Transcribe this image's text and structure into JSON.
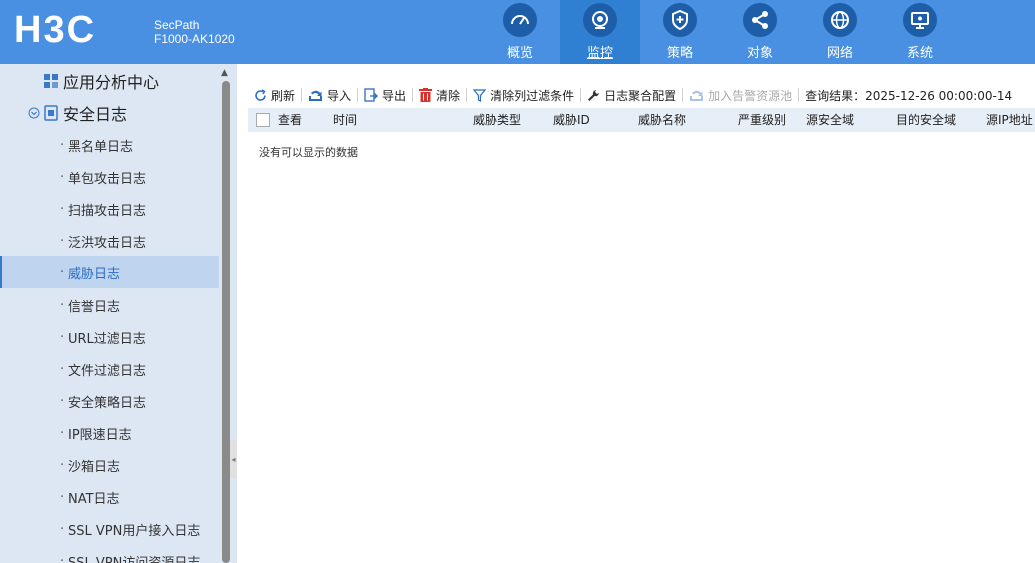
{
  "brand": {
    "logo_text": "H3C",
    "product_line": "SecPath",
    "model": "F1000-AK1020"
  },
  "nav": {
    "items": [
      {
        "label": "概览",
        "icon": "gauge-icon"
      },
      {
        "label": "监控",
        "icon": "camera-icon",
        "active": true
      },
      {
        "label": "策略",
        "icon": "shield-icon"
      },
      {
        "label": "对象",
        "icon": "share-icon"
      },
      {
        "label": "网络",
        "icon": "globe-icon"
      },
      {
        "label": "系统",
        "icon": "monitor-icon"
      }
    ]
  },
  "sidebar": {
    "group1": "应用分析中心",
    "group2": "安全日志",
    "items": [
      {
        "label": "黑名单日志"
      },
      {
        "label": "单包攻击日志"
      },
      {
        "label": "扫描攻击日志"
      },
      {
        "label": "泛洪攻击日志"
      },
      {
        "label": "威胁日志",
        "active": true
      },
      {
        "label": "信誉日志"
      },
      {
        "label": "URL过滤日志"
      },
      {
        "label": "文件过滤日志"
      },
      {
        "label": "安全策略日志"
      },
      {
        "label": "IP限速日志"
      },
      {
        "label": "沙箱日志"
      },
      {
        "label": "NAT日志"
      },
      {
        "label": "SSL VPN用户接入日志"
      },
      {
        "label": "SSL VPN访问资源日志"
      }
    ]
  },
  "toolbar": {
    "refresh": "刷新",
    "import": "导入",
    "export": "导出",
    "clear": "清除",
    "clear_filters": "清除列过滤条件",
    "aggregate": "日志聚合配置",
    "add_alarm": "加入告警资源池",
    "query_result": "查询结果：2025-12-26 00:00:00-14"
  },
  "table": {
    "columns": [
      "查看",
      "时间",
      "威胁类型",
      "威胁ID",
      "威胁名称",
      "严重级别",
      "源安全域",
      "目的安全域",
      "源IP地址"
    ],
    "empty_text": "没有可以显示的数据"
  }
}
